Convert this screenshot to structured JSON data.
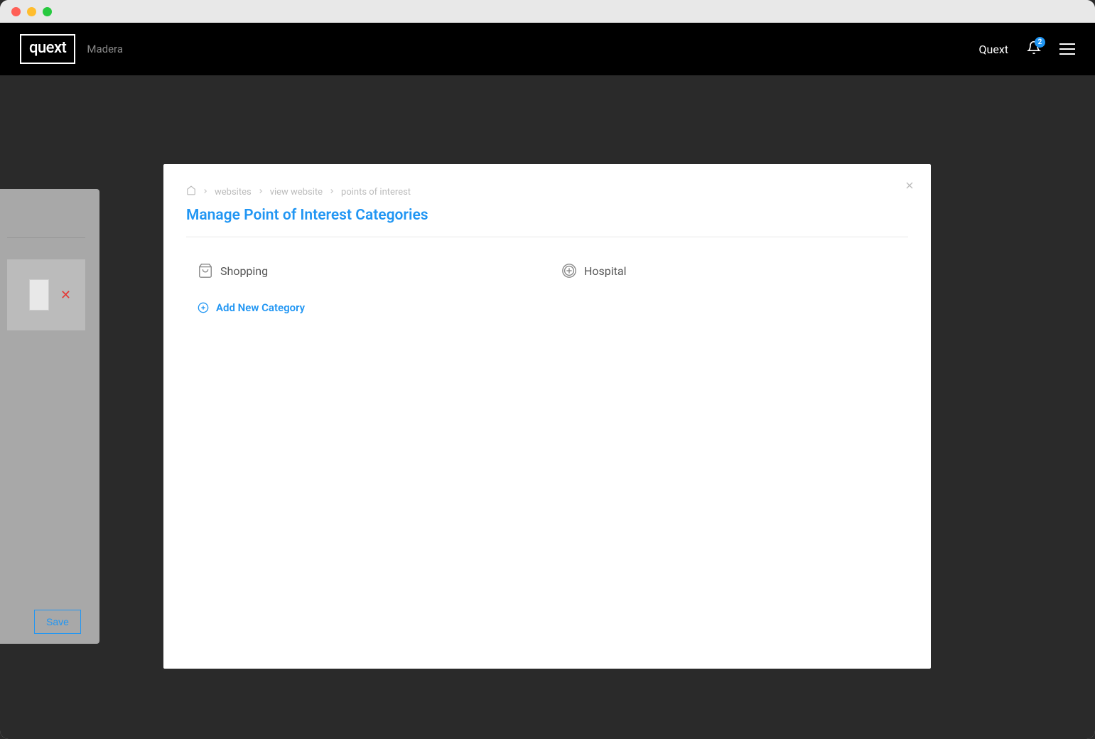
{
  "header": {
    "logo_text": "quext",
    "property_name": "Madera",
    "user_label": "Quext",
    "notification_count": "2"
  },
  "bg_panel": {
    "save_label": "Save"
  },
  "modal": {
    "breadcrumb": {
      "item1": "websites",
      "item2": "view website",
      "item3": "points of interest"
    },
    "title": "Manage Point of Interest Categories",
    "categories": [
      {
        "label": "Shopping",
        "icon": "shopping-bag"
      },
      {
        "label": "Hospital",
        "icon": "hospital"
      }
    ],
    "add_label": "Add New Category"
  }
}
